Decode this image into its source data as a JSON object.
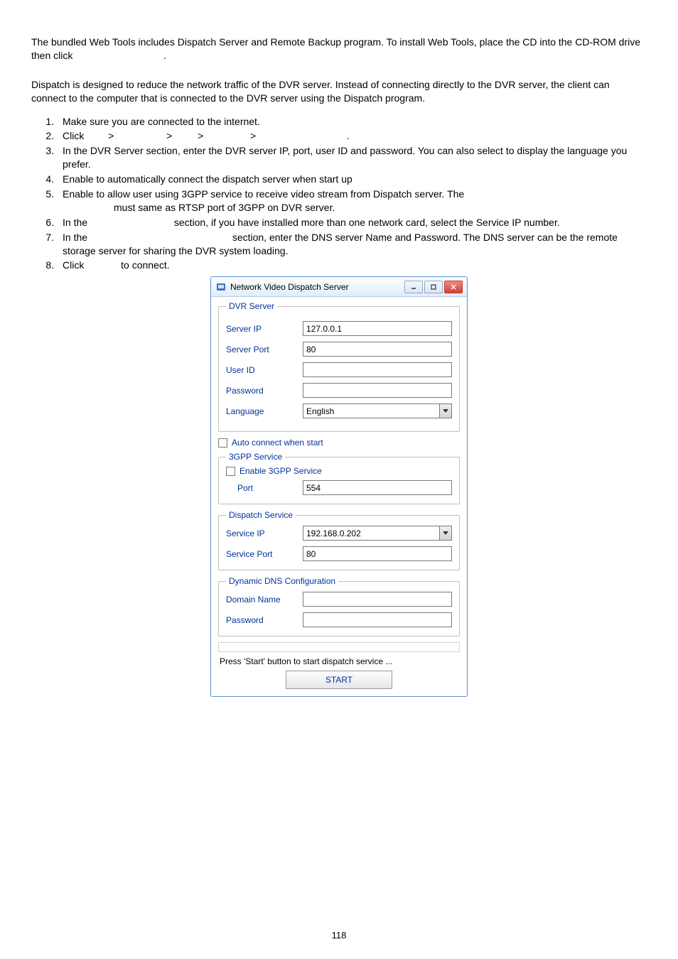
{
  "intro": {
    "line1": "The bundled Web Tools includes Dispatch Server and Remote Backup program. To install Web Tools, place the CD into the CD-ROM drive then click",
    "line1_tail": "."
  },
  "dispatch_intro": "Dispatch is designed to reduce the network traffic of the DVR server. Instead of connecting directly to the DVR server, the client can connect to the computer that is connected to the DVR server using the Dispatch program.",
  "steps": {
    "s1": "Make sure you are connected to the internet.",
    "s2_pre": "Click",
    "s2_tail": ".",
    "s3": "In the DVR Server section, enter the DVR server IP, port, user ID and password. You can also select to display the language you prefer.",
    "s4_sub": "Enable to automatically connect the dispatch server when start up",
    "s5_sub_a": "Enable to allow user using 3GPP service to receive video stream from Dispatch server. The",
    "s5_sub_b": "must same as RTSP port of 3GPP on DVR server.",
    "s6_pre": "In the",
    "s6_post": "section, if you have installed more than one network card, select the Service IP number.",
    "s7_pre": "In the",
    "s7_post": "section, enter the DNS server Name and Password. The DNS server can be the remote storage server for sharing the DVR system loading.",
    "s8_pre": "Click",
    "s8_post": "to connect."
  },
  "crumb_sep": ">",
  "dialog": {
    "title": "Network Video Dispatch Server",
    "groups": {
      "dvr_server": {
        "legend": "DVR Server",
        "server_ip_label": "Server IP",
        "server_ip_value": "127.0.0.1",
        "server_port_label": "Server Port",
        "server_port_value": "80",
        "user_id_label": "User ID",
        "user_id_value": "",
        "password_label": "Password",
        "password_value": "",
        "language_label": "Language",
        "language_value": "English"
      },
      "auto_connect": {
        "label": "Auto connect when start"
      },
      "gpp": {
        "legend": "3GPP Service",
        "enable_label": "Enable 3GPP Service",
        "port_label": "Port",
        "port_value": "554"
      },
      "dispatch": {
        "legend": "Dispatch Service",
        "service_ip_label": "Service IP",
        "service_ip_value": "192.168.0.202",
        "service_port_label": "Service Port",
        "service_port_value": "80"
      },
      "dns": {
        "legend": "Dynamic DNS Configuration",
        "domain_label": "Domain Name",
        "domain_value": "",
        "password_label": "Password",
        "password_value": ""
      }
    },
    "status": "Press 'Start' button to start dispatch service ...",
    "start_button": "START"
  },
  "page_number": "118"
}
